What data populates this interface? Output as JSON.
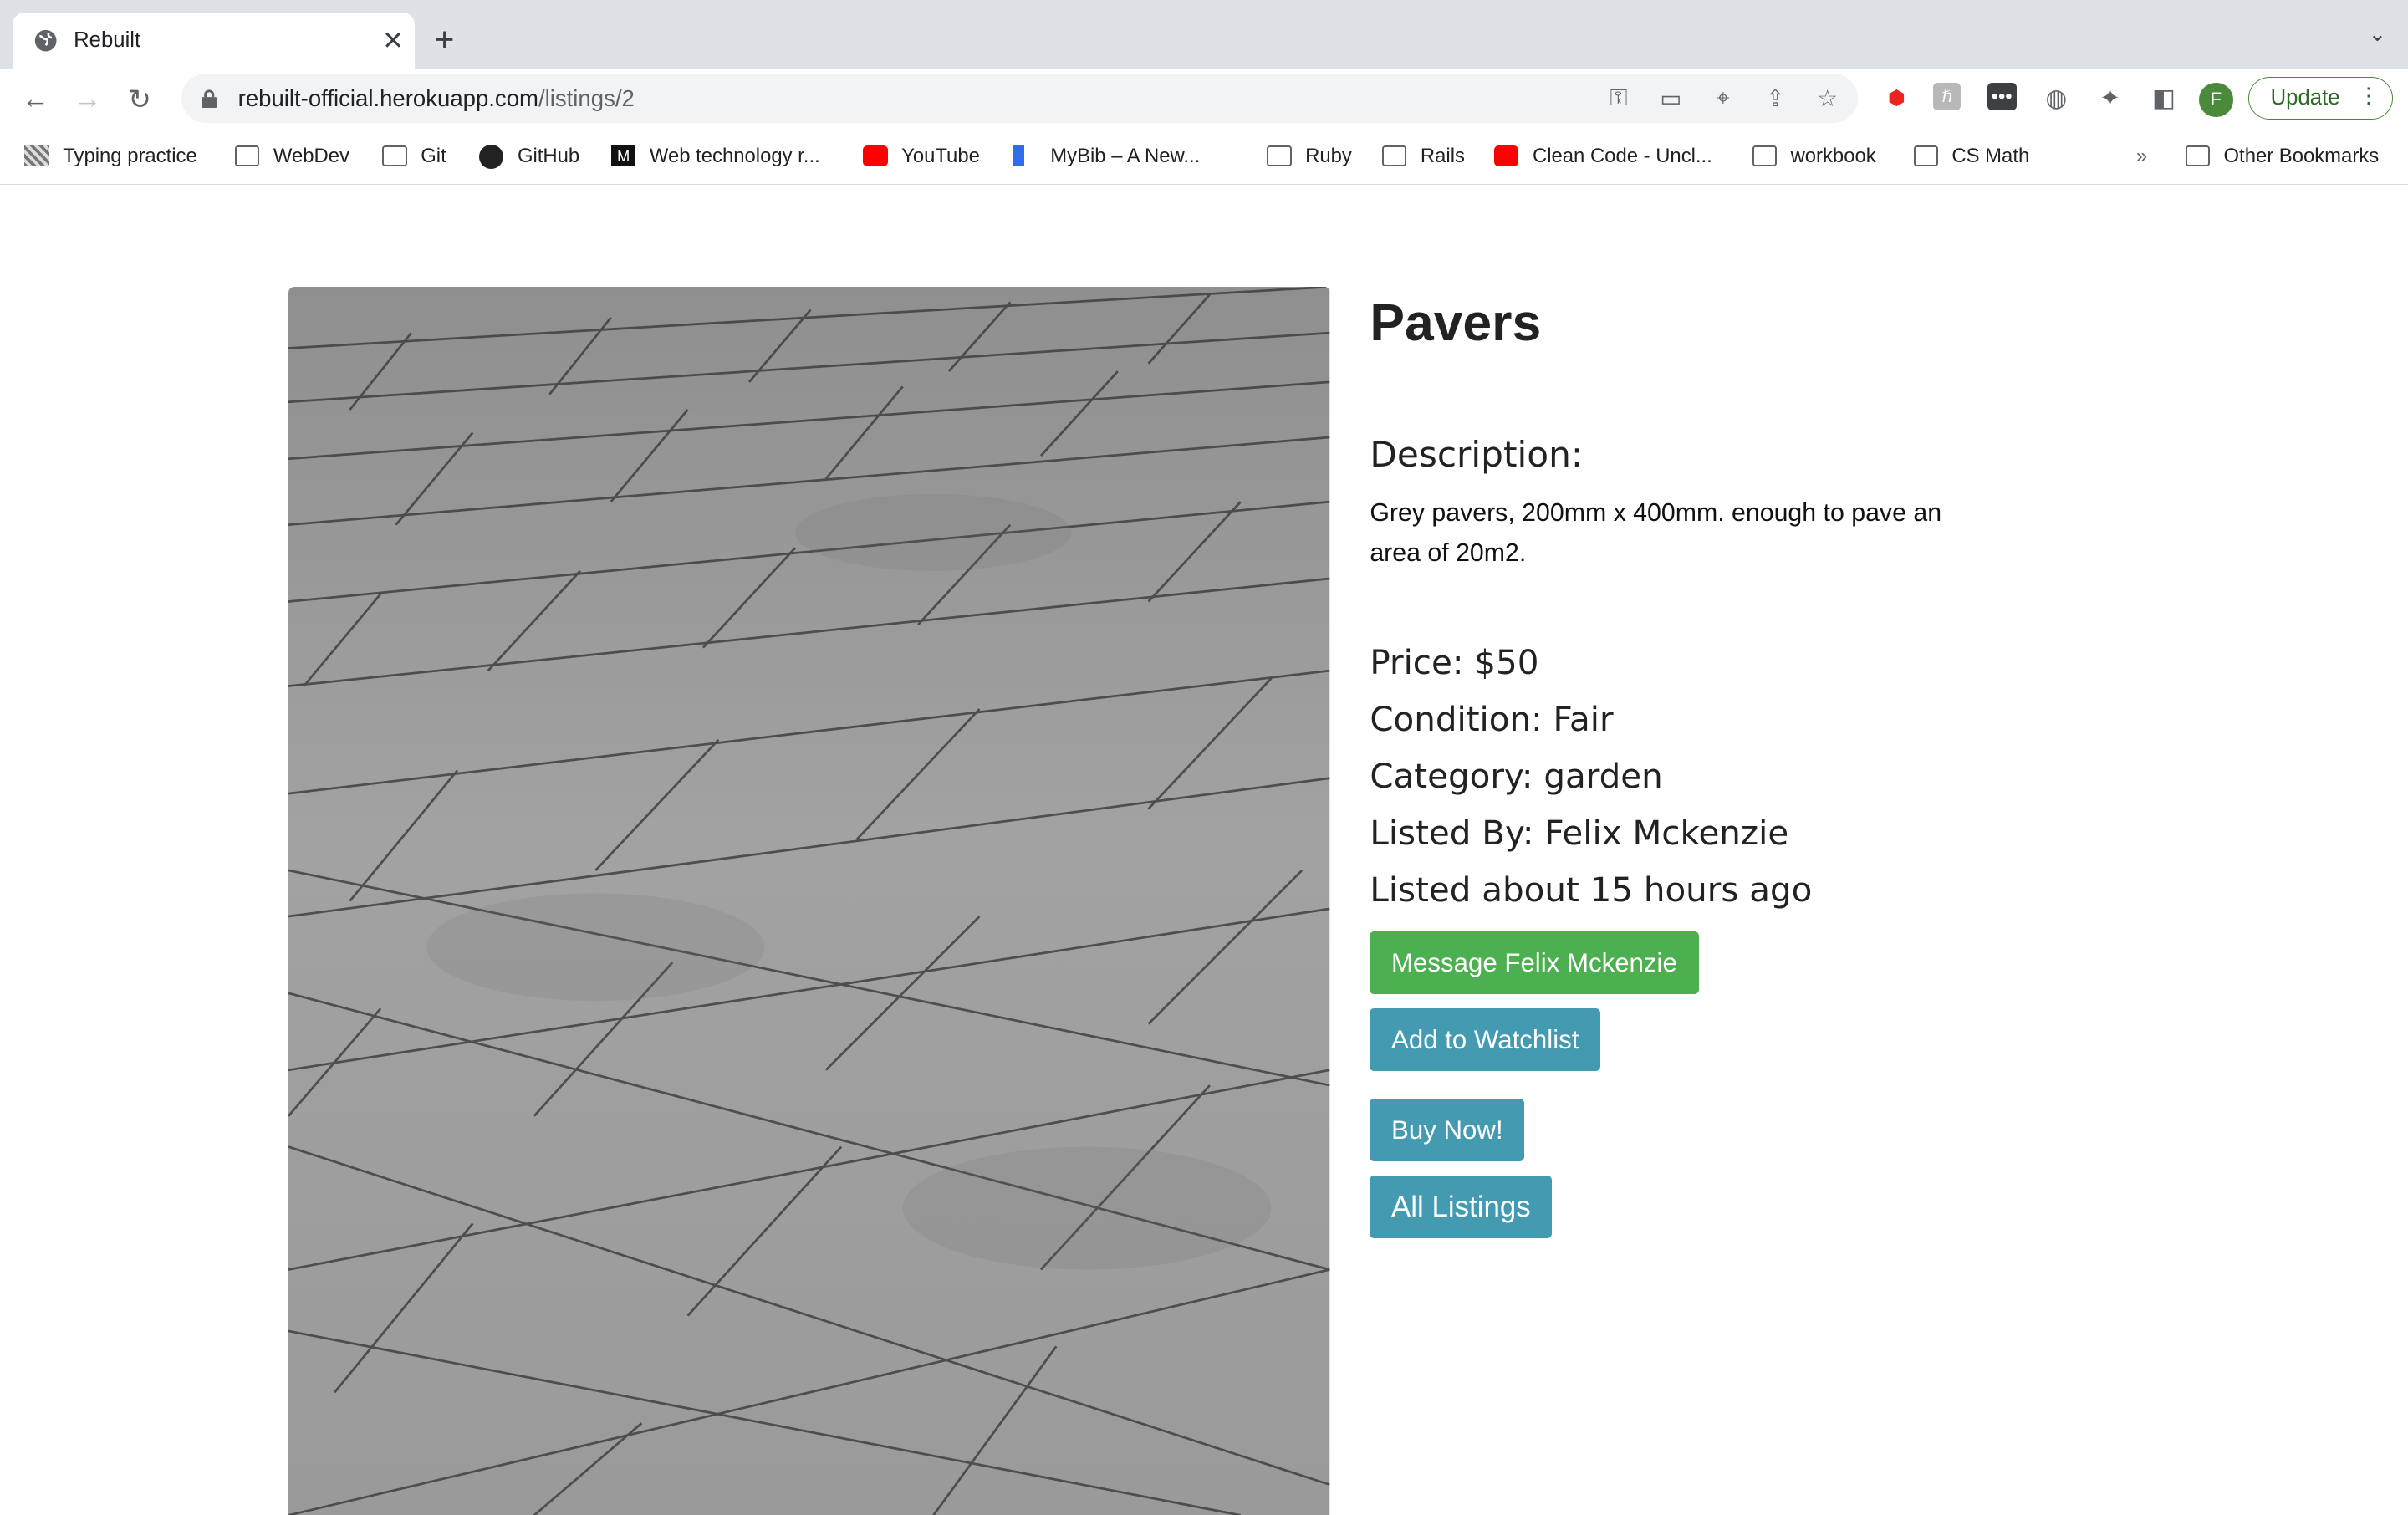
{
  "browser": {
    "tab_title": "Rebuilt",
    "url_host": "rebuilt-official.herokuapp.com",
    "url_path": "/listings/2",
    "update_label": "Update",
    "avatar_letter": "F"
  },
  "bookmarks": [
    {
      "label": "Typing practice",
      "icon": "typing-icon"
    },
    {
      "label": "WebDev",
      "icon": "folder-icon"
    },
    {
      "label": "Git",
      "icon": "folder-icon"
    },
    {
      "label": "GitHub",
      "icon": "github-icon"
    },
    {
      "label": "Web technology r...",
      "icon": "mdn-icon"
    },
    {
      "label": "YouTube",
      "icon": "youtube-icon"
    },
    {
      "label": "MyBib – A New...",
      "icon": "bookmark-icon"
    },
    {
      "label": "Ruby",
      "icon": "folder-icon"
    },
    {
      "label": "Rails",
      "icon": "folder-icon"
    },
    {
      "label": "Clean Code - Uncl...",
      "icon": "youtube-icon"
    },
    {
      "label": "workbook",
      "icon": "folder-icon"
    },
    {
      "label": "CS Math",
      "icon": "folder-icon"
    }
  ],
  "bookmarks_overflow": "»",
  "other_bookmarks": "Other Bookmarks",
  "listing": {
    "title": "Pavers",
    "description_heading": "Description:",
    "description": "Grey pavers, 200mm x 400mm. enough to pave an area of 20m2.",
    "price": "Price: $50",
    "condition": "Condition: Fair",
    "category": "Category: garden",
    "listed_by": "Listed By: Felix Mckenzie",
    "listed_time": "Listed about 15 hours ago"
  },
  "actions": {
    "message": "Message Felix Mckenzie",
    "watchlist": "Add to Watchlist",
    "buy": "Buy Now!",
    "all_listings": "All Listings"
  },
  "colors": {
    "message_button": "#4caf50",
    "action_button": "#449bb1"
  }
}
